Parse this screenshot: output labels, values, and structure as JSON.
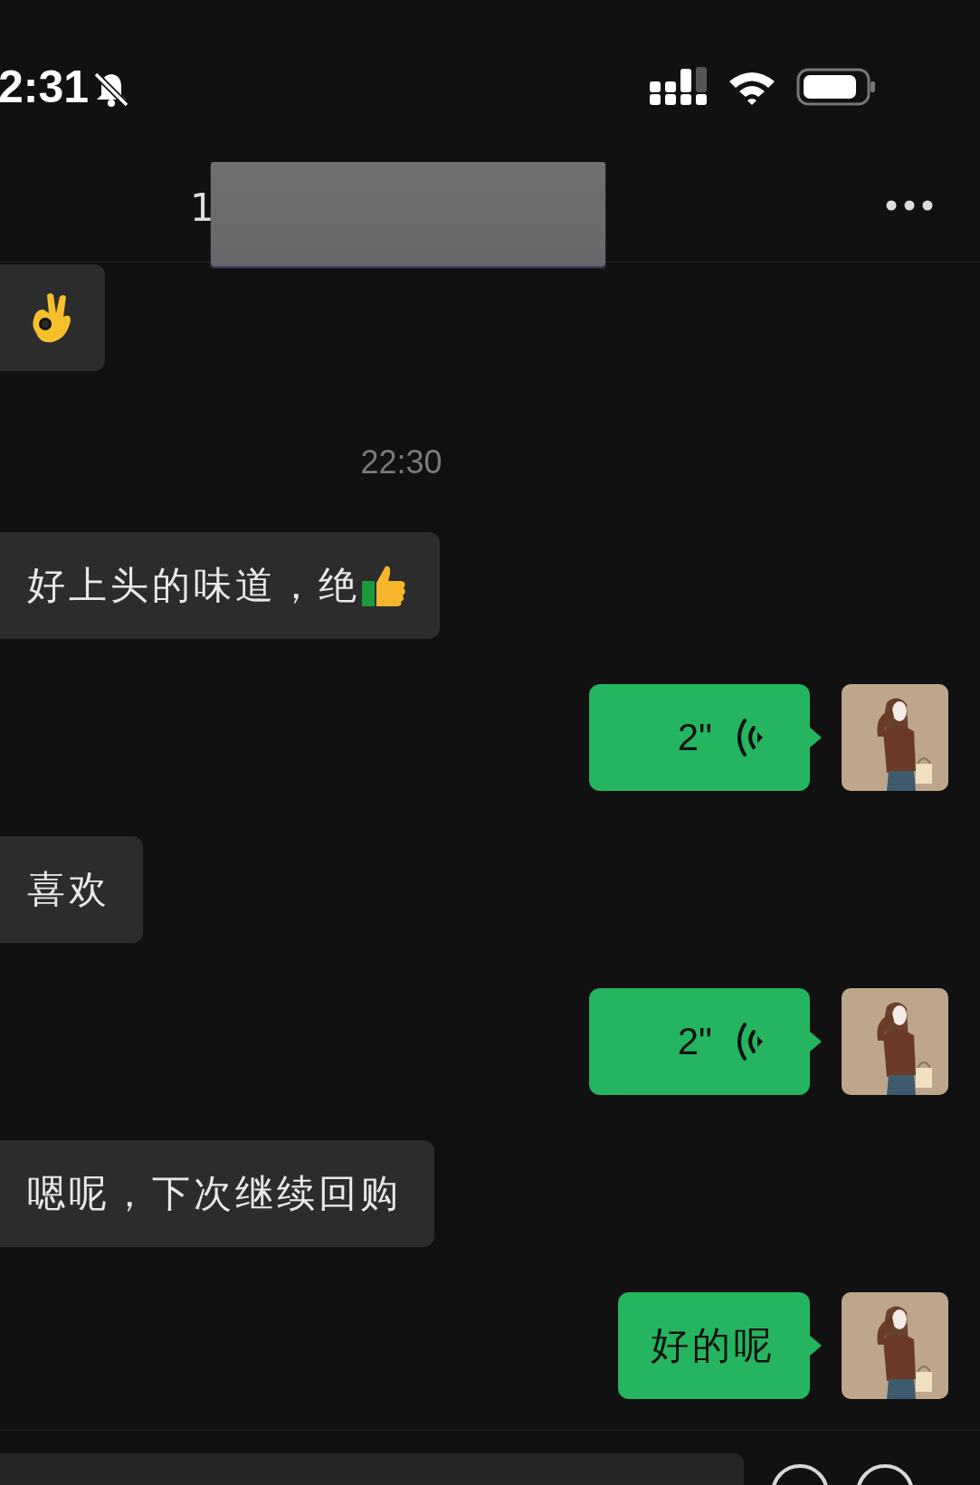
{
  "status_bar": {
    "time": "2:31",
    "muted": true
  },
  "nav": {
    "title": "1"
  },
  "messages": [
    {
      "kind": "emoji"
    },
    {
      "kind": "time",
      "text": "22:30"
    },
    {
      "kind": "received",
      "text": "好上头的味道，绝"
    },
    {
      "kind": "voice",
      "duration": "2\""
    },
    {
      "kind": "received",
      "text": "喜欢"
    },
    {
      "kind": "voice",
      "duration": "2\""
    },
    {
      "kind": "received",
      "text": "嗯呢，下次继续回购"
    },
    {
      "kind": "sent",
      "text": "好的呢"
    }
  ]
}
